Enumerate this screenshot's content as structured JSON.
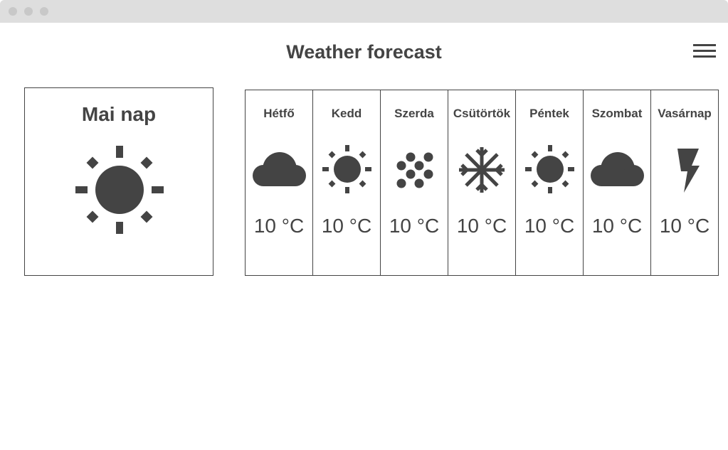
{
  "header": {
    "title": "Weather forecast",
    "menu_icon": "hamburger-menu-icon"
  },
  "today": {
    "title": "Mai nap",
    "icon": "sun-icon"
  },
  "forecast": [
    {
      "day": "Hétfő",
      "icon": "cloud-icon",
      "temp": "10 °C"
    },
    {
      "day": "Kedd",
      "icon": "sun-icon",
      "temp": "10 °C"
    },
    {
      "day": "Szerda",
      "icon": "hail-icon",
      "temp": "10 °C"
    },
    {
      "day": "Csütörtök",
      "icon": "snowflake-icon",
      "temp": "10 °C"
    },
    {
      "day": "Péntek",
      "icon": "sun-icon",
      "temp": "10 °C"
    },
    {
      "day": "Szombat",
      "icon": "cloud-icon",
      "temp": "10 °C"
    },
    {
      "day": "Vasárnap",
      "icon": "lightning-icon",
      "temp": "10 °C"
    }
  ],
  "colors": {
    "ink": "#444444",
    "window_bar": "#dedede",
    "window_dot": "#c8c8c8"
  }
}
